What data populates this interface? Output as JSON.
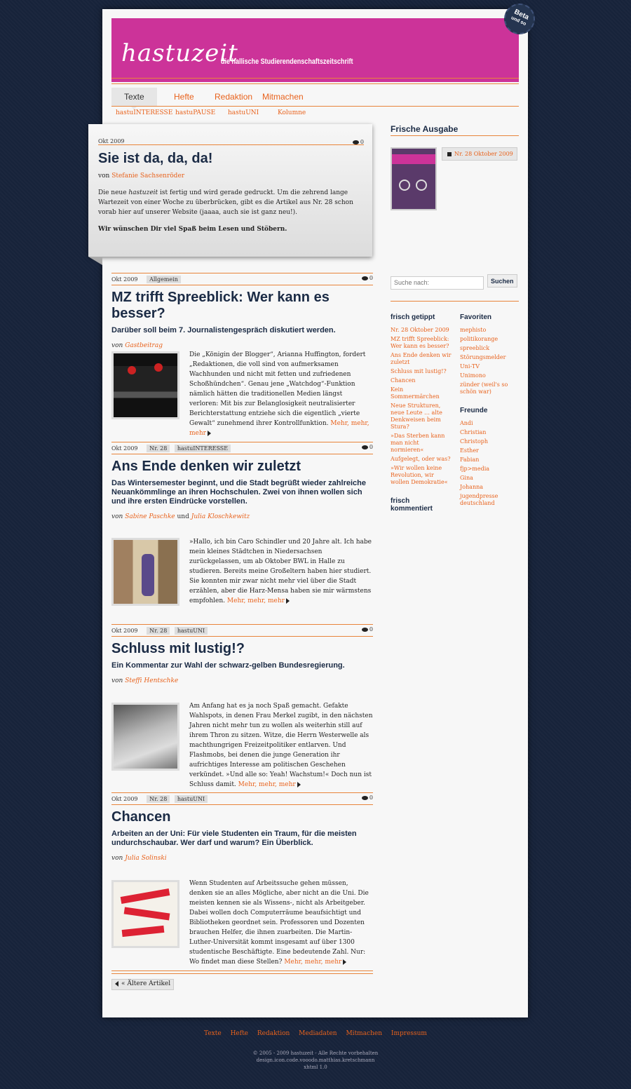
{
  "site": {
    "logo": "hastuzeit",
    "tagline": "die hallische Studierendenschaftszeitschrift",
    "beta": "Beta",
    "beta_sub": "und so"
  },
  "nav": {
    "items": [
      "Texte",
      "Hefte",
      "Redaktion",
      "Mitmachen"
    ],
    "sub": [
      "hastuINTERESSE",
      "hastuPAUSE",
      "hastuUNI",
      "Kolumne"
    ]
  },
  "featured": {
    "date": "Okt 2009",
    "comments": "0",
    "title": "Sie ist da, da, da!",
    "by_prefix": "von",
    "author": "Stefanie Sachsenröder",
    "p1_a": "Die neue ",
    "p1_em": "hastuzeit",
    "p1_b": " ist fertig und wird gerade gedruckt. Um die zehrend lange Wartezeit von einer Woche zu überbrücken, gibt es die Artikel aus  Nr. 28 schon vorab hier auf unserer Website (jaaaa, auch sie ist ganz neu!).",
    "p2": "Wir wünschen Dir viel Spaß beim Lesen und Stöbern."
  },
  "articles": [
    {
      "date": "Okt 2009",
      "tags": [
        "Allgemein"
      ],
      "comments": "0",
      "title": "MZ trifft Spreeblick: Wer kann es besser?",
      "subtitle": "Darüber soll beim 7. Journalistengespräch diskutiert werden.",
      "by_prefix": "von",
      "authors": [
        "Gastbeitrag"
      ],
      "text": "Die „Königin der Blogger“, Arianna Huffington, fordert „Redaktionen, die voll sind von aufmerksamen Wachhunden und nicht mit fetten und zufriedenen Schoßhündchen“. Genau jene „Watchdog“-Funktion nämlich hätten die traditionellen Medien längst verloren: Mit bis zur Belanglosigkeit neutralisierter Berichterstattung entziehe sich die eigentlich „vierte Gewalt“ zunehmend ihrer Kontrollfunktion.",
      "more": "Mehr, mehr, mehr"
    },
    {
      "date": "Okt 2009",
      "tags": [
        "Nr. 28",
        "hastuINTERESSE"
      ],
      "comments": "0",
      "title": "Ans Ende denken wir zuletzt",
      "subtitle": "Das Wintersemester beginnt, und die Stadt begrüßt wieder zahlreiche Neuankömmlinge an ihren Hochschulen. Zwei von ihnen wollen sich und ihre ersten Eindrücke vorstellen.",
      "by_prefix": "von",
      "authors": [
        "Sabine Paschke",
        "Julia Kloschkewitz"
      ],
      "and": "und",
      "text": "»Hallo, ich bin Caro Schindler und 20 Jahre alt. Ich habe mein kleines Städtchen in Niedersachsen zurückgelassen, um ab Oktober BWL in Halle zu studieren. Bereits meine Großeltern haben hier studiert. Sie konnten mir zwar nicht mehr viel über die Stadt erzählen, aber die Harz-Mensa haben sie mir wärmstens empfohlen.",
      "more": "Mehr, mehr, mehr"
    },
    {
      "date": "Okt 2009",
      "tags": [
        "Nr. 28",
        "hastuUNI"
      ],
      "comments": "0",
      "title": "Schluss mit lustig!?",
      "subtitle": "Ein Kommentar zur Wahl der schwarz-gelben Bundesregierung.",
      "by_prefix": "von",
      "authors": [
        "Steffi Hentschke"
      ],
      "text": "Am Anfang hat es ja noch Spaß gemacht. Gefakte Wahlspots, in denen Frau Merkel zugibt, in den nächsten Jahren nicht mehr tun zu wollen als weiterhin still auf ihrem Thron zu sitzen. Witze, die Herrn Westerwelle als machthungrigen Freizeitpolitiker entlarven. Und Flashmobs, bei denen die junge Generation ihr aufrichtiges Interesse am politischen Geschehen verkündet. »Und alle so: Yeah! Wachstum!« Doch nun ist Schluss damit.",
      "more": "Mehr, mehr, mehr"
    },
    {
      "date": "Okt 2009",
      "tags": [
        "Nr. 28",
        "hastuUNI"
      ],
      "comments": "0",
      "title": "Chancen",
      "subtitle": "Arbeiten an der Uni: Für viele Studenten ein Traum, für die meisten undurchschaubar. Wer darf und warum? Ein Überblick.",
      "by_prefix": "von",
      "authors": [
        "Julia Solinski"
      ],
      "text": "Wenn Studenten auf Arbeitssuche gehen müssen, denken sie an alles Mögliche, aber nicht an die Uni. Die meisten kennen sie als Wissens-, nicht als Arbeitgeber. Dabei wollen doch Computerräume beaufsichtigt und Bibliotheken geordnet sein. Professoren und Dozenten brauchen Helfer, die ihnen zuarbeiten. Die Martin-Luther-Universität kommt insgesamt auf über 1300 studentische Beschäftigte. Eine bedeutende Zahl. Nur: Wo findet man diese Stellen?",
      "more": "Mehr, mehr, mehr"
    }
  ],
  "older": "« Ältere Artikel",
  "sidebar": {
    "issue_heading": "Frische Ausgabe",
    "issue_link": "Nr. 28 Oktober 2009",
    "search_placeholder": "Suche nach:",
    "search_button": "Suchen",
    "fresh_heading": "frisch getippt",
    "fresh": [
      "Nr. 28 Oktober 2009",
      "MZ trifft Spreeblick: Wer kann es besser?",
      "Ans Ende denken wir zuletzt",
      "Schluss mit lustig!?",
      "Chancen",
      "Kein Sommermärchen",
      "Neue Strukturen, neue Leute … alte Denkweisen beim Stura?",
      "»Das Sterben kann man nicht normieren«",
      "Aufgelegt, oder was?",
      "»Wir wollen keine Revolution, wir wollen Demokratie«"
    ],
    "commented_heading": "frisch kommentiert",
    "fav_heading": "Favoriten",
    "favorites": [
      "mephisto",
      "politikorange",
      "spreeblick",
      "Störungsmelder",
      "Uni-TV",
      "Unimono",
      "zünder (weil's so schön war)"
    ],
    "friends_heading": "Freunde",
    "friends": [
      "Andi",
      "Christian",
      "Christoph",
      "Esther",
      "Fabian",
      "fjp>media",
      "Gina",
      "Johanna",
      "jugendpresse deutschland"
    ]
  },
  "footer": {
    "links": [
      "Texte",
      "Hefte",
      "Redaktion",
      "Mediadaten",
      "Mitmachen",
      "Impressum"
    ],
    "copy1": "© 2005 - 2009 hastuzeit - Alle Rechte vorbehalten",
    "copy2": "design.icon.code.vooodo.matthias.kretschmann",
    "copy3": "xhtml 1.0"
  }
}
